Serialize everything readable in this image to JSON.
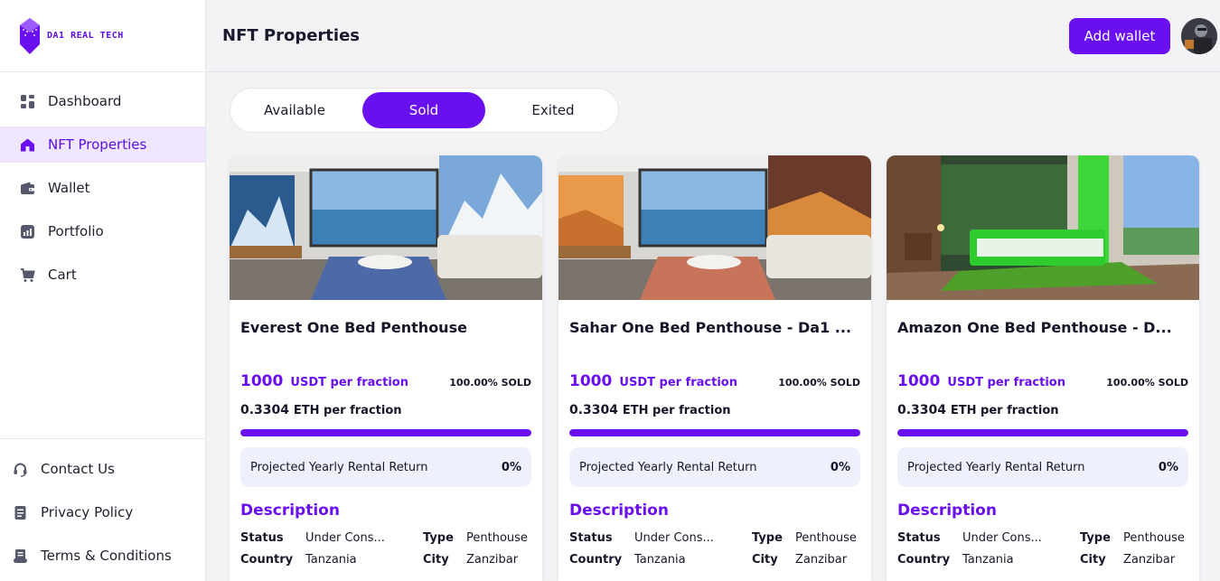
{
  "brand": {
    "name": "DA1 REAL TECH"
  },
  "sidebar": {
    "items": [
      {
        "label": "Dashboard",
        "icon": "grid-icon"
      },
      {
        "label": "NFT Properties",
        "icon": "home-icon",
        "active": true
      },
      {
        "label": "Wallet",
        "icon": "wallet-icon"
      },
      {
        "label": "Portfolio",
        "icon": "chart-icon"
      },
      {
        "label": "Cart",
        "icon": "cart-icon"
      }
    ],
    "bottom_items": [
      {
        "label": "Contact Us",
        "icon": "headset-icon"
      },
      {
        "label": "Privacy Policy",
        "icon": "document-icon"
      },
      {
        "label": "Terms & Conditions",
        "icon": "scroll-icon"
      }
    ]
  },
  "header": {
    "title": "NFT Properties",
    "add_wallet_label": "Add wallet"
  },
  "tabs": [
    {
      "label": "Available",
      "active": false
    },
    {
      "label": "Sold",
      "active": true
    },
    {
      "label": "Exited",
      "active": false
    }
  ],
  "colors": {
    "accent": "#6a0ff0",
    "active_bg": "#f0e6ff",
    "rental_bg": "#eef0fb"
  },
  "cards": [
    {
      "title": "Everest One Bed Penthouse",
      "price": "1000",
      "price_unit": "USDT per fraction",
      "sold": "100.00% SOLD",
      "progress": 1.0,
      "eth": "0.3304",
      "eth_unit": "ETH per fraction",
      "rental_label": "Projected Yearly Rental Return",
      "rental_value": "0%",
      "description_title": "Description",
      "status_label": "Status",
      "status": "Under Cons...",
      "type_label": "Type",
      "type": "Penthouse",
      "country_label": "Country",
      "country": "Tanzania",
      "city_label": "City",
      "city": "Zanzibar"
    },
    {
      "title": "Sahar One Bed Penthouse - Da1 ...",
      "price": "1000",
      "price_unit": "USDT per fraction",
      "sold": "100.00% SOLD",
      "progress": 1.0,
      "eth": "0.3304",
      "eth_unit": "ETH per fraction",
      "rental_label": "Projected Yearly Rental Return",
      "rental_value": "0%",
      "description_title": "Description",
      "status_label": "Status",
      "status": "Under Cons...",
      "type_label": "Type",
      "type": "Penthouse",
      "country_label": "Country",
      "country": "Tanzania",
      "city_label": "City",
      "city": "Zanzibar"
    },
    {
      "title": "Amazon One Bed Penthouse - D...",
      "price": "1000",
      "price_unit": "USDT per fraction",
      "sold": "100.00% SOLD",
      "progress": 1.0,
      "eth": "0.3304",
      "eth_unit": "ETH per fraction",
      "rental_label": "Projected Yearly Rental Return",
      "rental_value": "0%",
      "description_title": "Description",
      "status_label": "Status",
      "status": "Under Cons...",
      "type_label": "Type",
      "type": "Penthouse",
      "country_label": "Country",
      "country": "Tanzania",
      "city_label": "City",
      "city": "Zanzibar"
    }
  ]
}
